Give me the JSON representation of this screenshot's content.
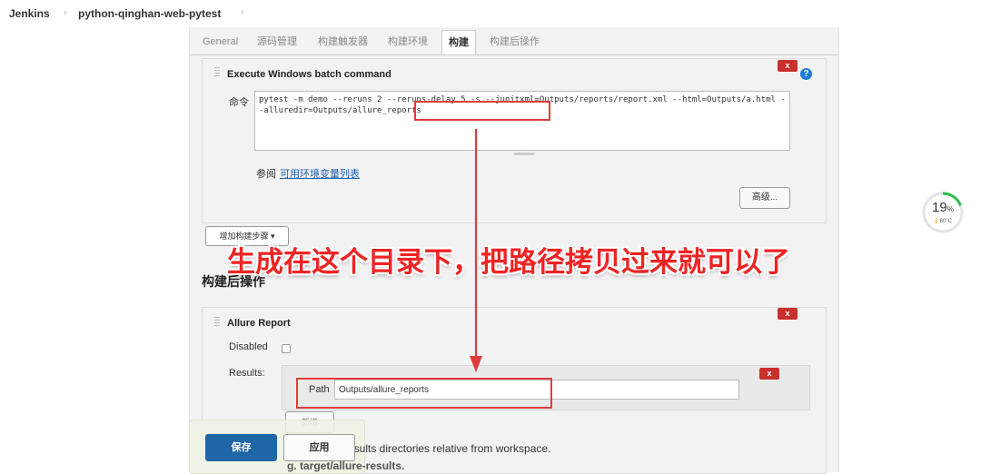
{
  "breadcrumb": {
    "items": [
      "Jenkins",
      "python-qinghan-web-pytest"
    ]
  },
  "tabs": [
    {
      "label": "General",
      "active": false
    },
    {
      "label": "源码管理",
      "active": false
    },
    {
      "label": "构建触发器",
      "active": false
    },
    {
      "label": "构建环境",
      "active": false
    },
    {
      "label": "构建",
      "active": true
    },
    {
      "label": "构建后操作",
      "active": false
    }
  ],
  "build_step": {
    "title": "Execute Windows batch command",
    "delete_label": "x",
    "help_label": "?",
    "command_label": "命令",
    "command_value": "pytest -m demo --reruns 2 --reruns-delay 5 -s --junitxml=Outputs/reports/report.xml --html=Outputs/a.html --alluredir=Outputs/allure_reports",
    "see_label": "参阅",
    "env_link": "可用环境变量列表",
    "advanced_label": "高级..."
  },
  "add_step_label": "增加构建步骤 ▾",
  "post_build": {
    "heading": "构建后操作",
    "allure": {
      "title": "Allure Report",
      "delete_label": "x",
      "disabled_label": "Disabled",
      "results_label": "Results:",
      "path_label": "Path",
      "path_value": "Outputs/allure_reports",
      "path_delete_label": "x",
      "add_label": "新增",
      "hint_text": "esults directories relative from workspace.",
      "hint_example": "g. target/allure-results."
    }
  },
  "actions": {
    "save_label": "保存",
    "apply_label": "应用"
  },
  "annotation": {
    "text": "生成在这个目录下，把路径拷贝过来就可以了",
    "color": "#ee2424"
  },
  "gauge": {
    "percent": 19,
    "percent_suffix": "%",
    "temperature": "60°C",
    "accent": "#2dbb4e"
  }
}
